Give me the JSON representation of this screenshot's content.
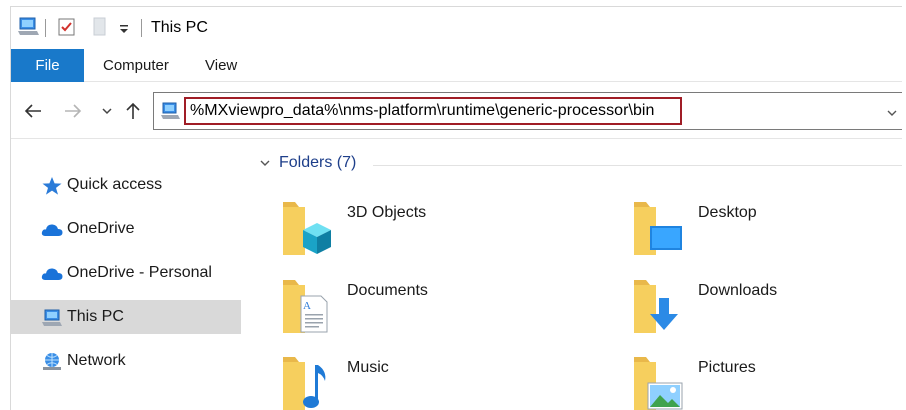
{
  "window": {
    "title": "This PC"
  },
  "ribbon": {
    "tabs": [
      {
        "label": "File"
      },
      {
        "label": "Computer"
      },
      {
        "label": "View"
      }
    ]
  },
  "address_bar": {
    "path": "%MXviewpro_data%\\nms-platform\\runtime\\generic-processor\\bin"
  },
  "sidebar": {
    "items": [
      {
        "label": "Quick access",
        "icon": "star-icon"
      },
      {
        "label": "OneDrive",
        "icon": "cloud-icon"
      },
      {
        "label": "OneDrive - Personal",
        "icon": "cloud-icon"
      },
      {
        "label": "This PC",
        "icon": "computer-icon",
        "selected": true
      },
      {
        "label": "Network",
        "icon": "network-icon"
      }
    ]
  },
  "content": {
    "group_label": "Folders (7)",
    "folders": [
      {
        "label": "3D Objects",
        "icon": "3d-objects-folder-icon"
      },
      {
        "label": "Desktop",
        "icon": "desktop-folder-icon"
      },
      {
        "label": "Documents",
        "icon": "documents-folder-icon"
      },
      {
        "label": "Downloads",
        "icon": "downloads-folder-icon"
      },
      {
        "label": "Music",
        "icon": "music-folder-icon"
      },
      {
        "label": "Pictures",
        "icon": "pictures-folder-icon"
      }
    ]
  },
  "colors": {
    "file_tab": "#1979ca",
    "address_highlight": "#a01d26",
    "folder_yellow": "#f6cf5e",
    "group_header": "#1e3f8a",
    "selected_bg": "#d9d9d9"
  }
}
